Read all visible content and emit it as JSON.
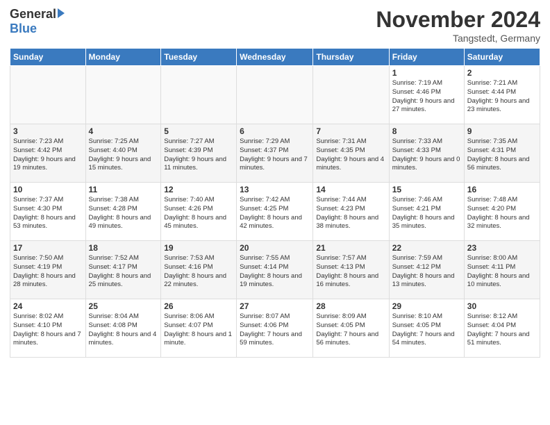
{
  "header": {
    "logo_general": "General",
    "logo_blue": "Blue",
    "month_title": "November 2024",
    "location": "Tangstedt, Germany"
  },
  "days_of_week": [
    "Sunday",
    "Monday",
    "Tuesday",
    "Wednesday",
    "Thursday",
    "Friday",
    "Saturday"
  ],
  "weeks": [
    [
      {
        "day": "",
        "info": ""
      },
      {
        "day": "",
        "info": ""
      },
      {
        "day": "",
        "info": ""
      },
      {
        "day": "",
        "info": ""
      },
      {
        "day": "",
        "info": ""
      },
      {
        "day": "1",
        "info": "Sunrise: 7:19 AM\nSunset: 4:46 PM\nDaylight: 9 hours and 27 minutes."
      },
      {
        "day": "2",
        "info": "Sunrise: 7:21 AM\nSunset: 4:44 PM\nDaylight: 9 hours and 23 minutes."
      }
    ],
    [
      {
        "day": "3",
        "info": "Sunrise: 7:23 AM\nSunset: 4:42 PM\nDaylight: 9 hours and 19 minutes."
      },
      {
        "day": "4",
        "info": "Sunrise: 7:25 AM\nSunset: 4:40 PM\nDaylight: 9 hours and 15 minutes."
      },
      {
        "day": "5",
        "info": "Sunrise: 7:27 AM\nSunset: 4:39 PM\nDaylight: 9 hours and 11 minutes."
      },
      {
        "day": "6",
        "info": "Sunrise: 7:29 AM\nSunset: 4:37 PM\nDaylight: 9 hours and 7 minutes."
      },
      {
        "day": "7",
        "info": "Sunrise: 7:31 AM\nSunset: 4:35 PM\nDaylight: 9 hours and 4 minutes."
      },
      {
        "day": "8",
        "info": "Sunrise: 7:33 AM\nSunset: 4:33 PM\nDaylight: 9 hours and 0 minutes."
      },
      {
        "day": "9",
        "info": "Sunrise: 7:35 AM\nSunset: 4:31 PM\nDaylight: 8 hours and 56 minutes."
      }
    ],
    [
      {
        "day": "10",
        "info": "Sunrise: 7:37 AM\nSunset: 4:30 PM\nDaylight: 8 hours and 53 minutes."
      },
      {
        "day": "11",
        "info": "Sunrise: 7:38 AM\nSunset: 4:28 PM\nDaylight: 8 hours and 49 minutes."
      },
      {
        "day": "12",
        "info": "Sunrise: 7:40 AM\nSunset: 4:26 PM\nDaylight: 8 hours and 45 minutes."
      },
      {
        "day": "13",
        "info": "Sunrise: 7:42 AM\nSunset: 4:25 PM\nDaylight: 8 hours and 42 minutes."
      },
      {
        "day": "14",
        "info": "Sunrise: 7:44 AM\nSunset: 4:23 PM\nDaylight: 8 hours and 38 minutes."
      },
      {
        "day": "15",
        "info": "Sunrise: 7:46 AM\nSunset: 4:21 PM\nDaylight: 8 hours and 35 minutes."
      },
      {
        "day": "16",
        "info": "Sunrise: 7:48 AM\nSunset: 4:20 PM\nDaylight: 8 hours and 32 minutes."
      }
    ],
    [
      {
        "day": "17",
        "info": "Sunrise: 7:50 AM\nSunset: 4:19 PM\nDaylight: 8 hours and 28 minutes."
      },
      {
        "day": "18",
        "info": "Sunrise: 7:52 AM\nSunset: 4:17 PM\nDaylight: 8 hours and 25 minutes."
      },
      {
        "day": "19",
        "info": "Sunrise: 7:53 AM\nSunset: 4:16 PM\nDaylight: 8 hours and 22 minutes."
      },
      {
        "day": "20",
        "info": "Sunrise: 7:55 AM\nSunset: 4:14 PM\nDaylight: 8 hours and 19 minutes."
      },
      {
        "day": "21",
        "info": "Sunrise: 7:57 AM\nSunset: 4:13 PM\nDaylight: 8 hours and 16 minutes."
      },
      {
        "day": "22",
        "info": "Sunrise: 7:59 AM\nSunset: 4:12 PM\nDaylight: 8 hours and 13 minutes."
      },
      {
        "day": "23",
        "info": "Sunrise: 8:00 AM\nSunset: 4:11 PM\nDaylight: 8 hours and 10 minutes."
      }
    ],
    [
      {
        "day": "24",
        "info": "Sunrise: 8:02 AM\nSunset: 4:10 PM\nDaylight: 8 hours and 7 minutes."
      },
      {
        "day": "25",
        "info": "Sunrise: 8:04 AM\nSunset: 4:08 PM\nDaylight: 8 hours and 4 minutes."
      },
      {
        "day": "26",
        "info": "Sunrise: 8:06 AM\nSunset: 4:07 PM\nDaylight: 8 hours and 1 minute."
      },
      {
        "day": "27",
        "info": "Sunrise: 8:07 AM\nSunset: 4:06 PM\nDaylight: 7 hours and 59 minutes."
      },
      {
        "day": "28",
        "info": "Sunrise: 8:09 AM\nSunset: 4:05 PM\nDaylight: 7 hours and 56 minutes."
      },
      {
        "day": "29",
        "info": "Sunrise: 8:10 AM\nSunset: 4:05 PM\nDaylight: 7 hours and 54 minutes."
      },
      {
        "day": "30",
        "info": "Sunrise: 8:12 AM\nSunset: 4:04 PM\nDaylight: 7 hours and 51 minutes."
      }
    ]
  ]
}
